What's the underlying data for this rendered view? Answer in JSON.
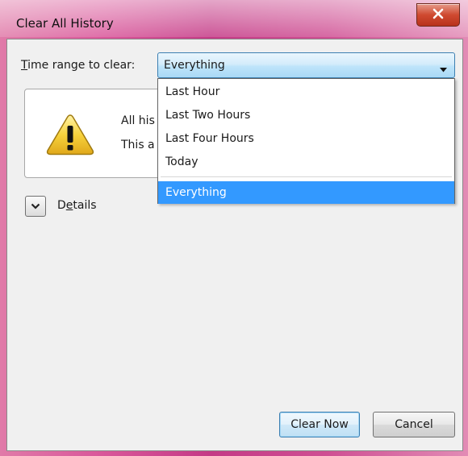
{
  "window": {
    "title": "Clear All History",
    "close_icon": "close-icon"
  },
  "time_range": {
    "label_accesskey": "T",
    "label_rest": "ime range to clear:",
    "selected": "Everything",
    "options": [
      "Last Hour",
      "Last Two Hours",
      "Last Four Hours",
      "Today",
      "Everything"
    ],
    "selected_index": 4
  },
  "warning_panel": {
    "icon": "warning-icon",
    "line1": "All his",
    "line2": "This a"
  },
  "details": {
    "label_prefix": "D",
    "label_accesskey": "e",
    "label_rest": "tails",
    "icon": "chevron-down-icon"
  },
  "buttons": {
    "clear_now": "Clear Now",
    "cancel": "Cancel"
  },
  "colors": {
    "selection": "#3399ff",
    "accent_border": "#3c7fb1",
    "close_button": "#cf4a30"
  }
}
